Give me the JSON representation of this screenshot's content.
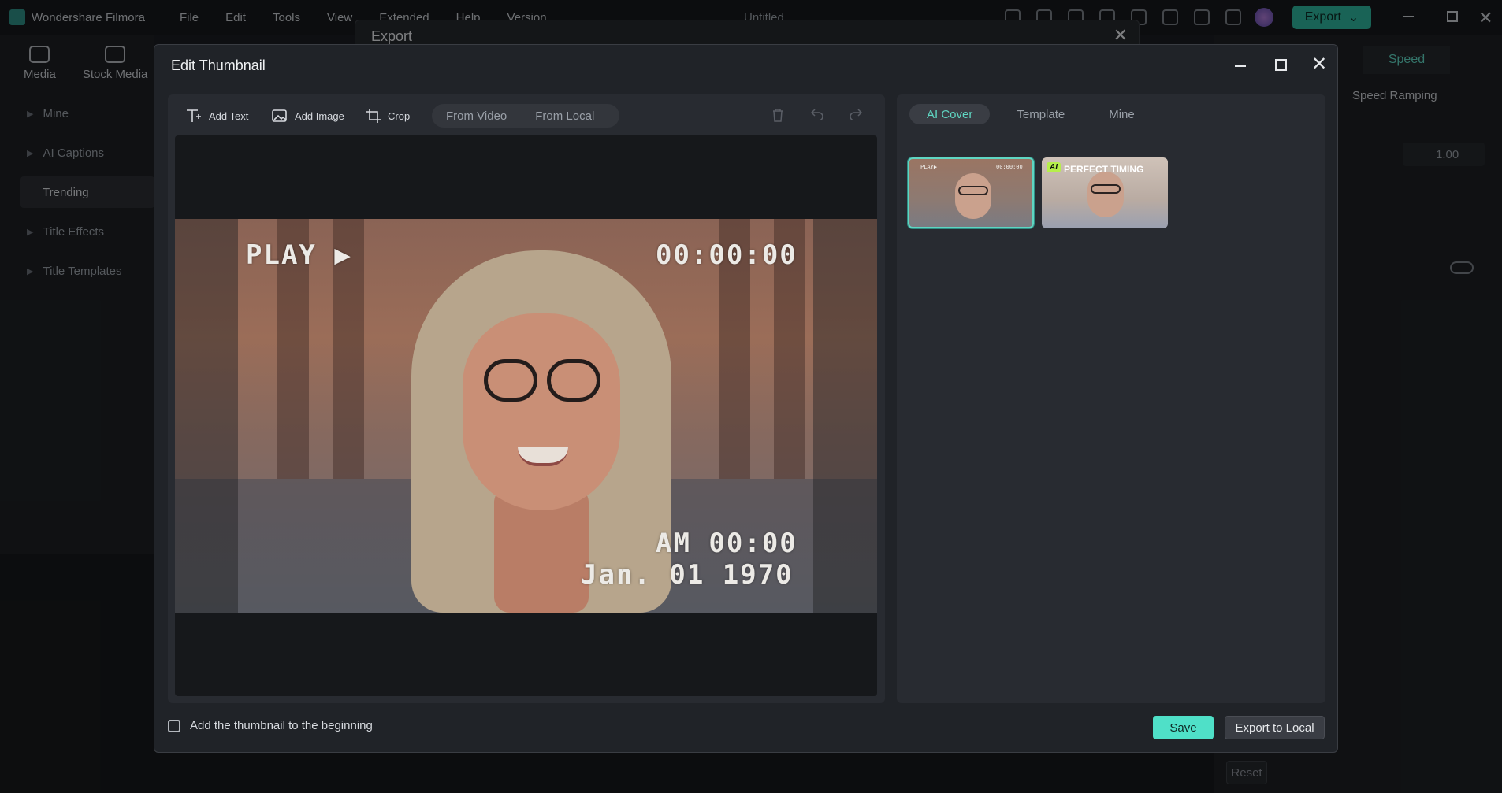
{
  "app": {
    "name": "Wondershare Filmora",
    "menu": [
      "File",
      "Edit",
      "Tools",
      "View",
      "Extended",
      "Help",
      "Version"
    ],
    "document_title": "Untitled",
    "export_label": "Export"
  },
  "left_panel": {
    "tabs": [
      "Media",
      "Stock Media"
    ],
    "items": [
      {
        "label": "Mine",
        "active": false
      },
      {
        "label": "AI Captions",
        "active": false
      },
      {
        "label": "Trending",
        "active": true
      },
      {
        "label": "Title Effects",
        "active": false
      },
      {
        "label": "Title Templates",
        "active": false
      }
    ]
  },
  "right_panel": {
    "tab": "Speed",
    "speed_ramping": "Speed Ramping",
    "speed_value": "1.00",
    "reset_label": "Reset"
  },
  "export_dialog": {
    "title": "Export"
  },
  "edit_thumbnail": {
    "title": "Edit Thumbnail",
    "tools": {
      "add_text": "Add Text",
      "add_image": "Add Image",
      "crop": "Crop",
      "from_video": "From Video",
      "from_local": "From Local"
    },
    "overlay": {
      "play": "PLAY ▶",
      "timecode": "00:00:00",
      "am_time": "AM 00:00",
      "date": "Jan. 01 1970"
    },
    "cover_tabs": {
      "ai_cover": "AI Cover",
      "template": "Template",
      "mine": "Mine"
    },
    "thumbnails": {
      "first_play": "PLAY▶",
      "first_tc": "00:00:00",
      "second_badge": "AI",
      "second_text": "PERFECT TIMING"
    },
    "checkbox_label": "Add the thumbnail to the beginning",
    "save_label": "Save",
    "export_local_label": "Export to Local"
  },
  "colors": {
    "accent": "#4fe0c8",
    "dialog_bg": "#202328",
    "panel_bg": "#282b31"
  }
}
